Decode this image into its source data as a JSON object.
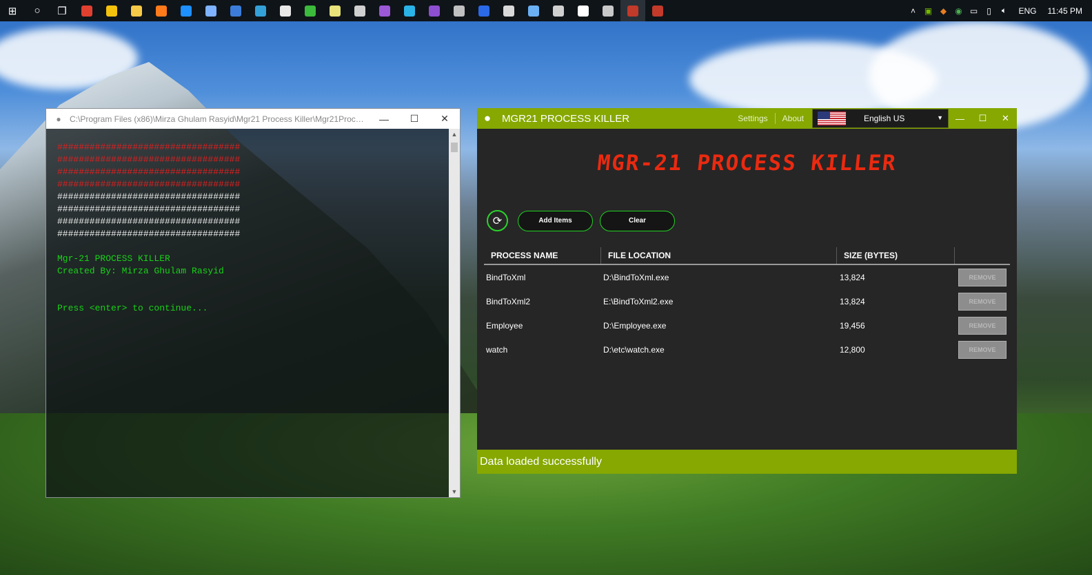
{
  "taskbar": {
    "language": "ENG",
    "time": "11:45 PM",
    "apps": [
      {
        "name": "start-button",
        "color": "#ffffff"
      },
      {
        "name": "cortana-button",
        "color": "#ffffff"
      },
      {
        "name": "task-view-button",
        "color": "#ffffff"
      },
      {
        "name": "app-red",
        "color": "#e04030"
      },
      {
        "name": "chrome-app",
        "color": "#f4c20d"
      },
      {
        "name": "file-explorer-app",
        "color": "#f7c948"
      },
      {
        "name": "firefox-app",
        "color": "#ff7a1a"
      },
      {
        "name": "edge-app",
        "color": "#1e90ff"
      },
      {
        "name": "app-box",
        "color": "#7fb2ff"
      },
      {
        "name": "app-blue-square",
        "color": "#3c7dd9"
      },
      {
        "name": "xamarin-app",
        "color": "#34a0d8"
      },
      {
        "name": "store-app",
        "color": "#e8e8e8"
      },
      {
        "name": "utorrent-app",
        "color": "#3cba3c"
      },
      {
        "name": "notepad-app",
        "color": "#e8e37a"
      },
      {
        "name": "app-character",
        "color": "#d0d0d0"
      },
      {
        "name": "visual-studio-app",
        "color": "#9b59d6"
      },
      {
        "name": "app-cyan",
        "color": "#2ab3e6"
      },
      {
        "name": "visual-studio-2-app",
        "color": "#8e4fd1"
      },
      {
        "name": "app-disk",
        "color": "#c0c0c0"
      },
      {
        "name": "photoshop-app",
        "color": "#2a6ae8"
      },
      {
        "name": "app-window",
        "color": "#d9d9d9"
      },
      {
        "name": "app-monitor",
        "color": "#6ab0f2"
      },
      {
        "name": "app-pen",
        "color": "#d0d0d0"
      },
      {
        "name": "camera-app",
        "color": "#ffffff"
      },
      {
        "name": "app-database",
        "color": "#c8c8c8"
      },
      {
        "name": "process-killer-console-app",
        "color": "#c23a2a"
      },
      {
        "name": "process-killer-app",
        "color": "#c23a2a"
      }
    ]
  },
  "console": {
    "title": "C:\\Program Files (x86)\\Mirza Ghulam Rasyid\\Mgr21 Process Killer\\Mgr21ProcKille...",
    "red_rows": [
      "##################################",
      "##################################",
      "##################################",
      "##################################"
    ],
    "white_rows": [
      "##################################",
      "##################################",
      "##################################",
      "##################################"
    ],
    "line1": "Mgr-21 PROCESS KILLER",
    "line2": "Created By: Mirza Ghulam Rasyid",
    "line3": "Press <enter> to continue..."
  },
  "app": {
    "title": "MGR21 PROCESS KILLER",
    "settings": "Settings",
    "about": "About",
    "language": "English US",
    "heading": "MGR-21 PROCESS KILLER",
    "add_items": "Add Items",
    "clear": "Clear",
    "columns": [
      "PROCESS NAME",
      "FILE LOCATION",
      "SIZE (BYTES)",
      ""
    ],
    "rows": [
      {
        "name": "BindToXml",
        "location": "D:\\BindToXml.exe",
        "size": "13,824",
        "action": "REMOVE"
      },
      {
        "name": "BindToXml2",
        "location": "E:\\BindToXml2.exe",
        "size": "13,824",
        "action": "REMOVE"
      },
      {
        "name": "Employee",
        "location": "D:\\Employee.exe",
        "size": "19,456",
        "action": "REMOVE"
      },
      {
        "name": "watch",
        "location": "D:\\etc\\watch.exe",
        "size": "12,800",
        "action": "REMOVE"
      }
    ],
    "status": "Data loaded successfully",
    "accent_color": "#86a800",
    "heading_color": "#ea2a10"
  }
}
